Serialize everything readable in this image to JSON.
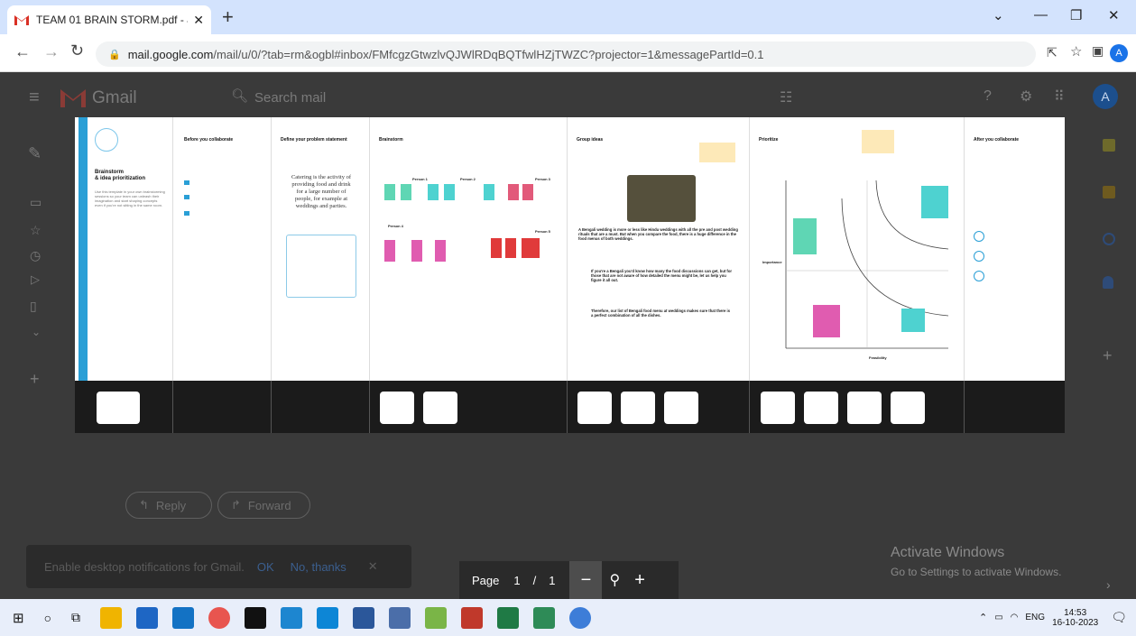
{
  "browser": {
    "tab_title": "TEAM 01 BRAIN STORM.pdf - as",
    "url_host": "mail.google.com",
    "url_rest": "/mail/u/0/?tab=rm&ogbl#inbox/FMfcgzGtwzlvQJWlRDqBQTfwlHZjTWZC?projector=1&messagePartId=0.1",
    "profile_initial": "A"
  },
  "gmail": {
    "product": "Gmail",
    "search_placeholder": "Search mail",
    "reply": "Reply",
    "forward": "Forward",
    "notif_text": "Enable desktop notifications for Gmail.",
    "notif_ok": "OK",
    "notif_no": "No, thanks"
  },
  "doc": {
    "col1": {
      "title": "Brainstorm",
      "title2": "& idea prioritization",
      "body": "Use this template in your own brainstorming sessions so your team can unleash their imagination and start shaping concepts even if you're not sitting in the same room."
    },
    "col2": {
      "title": "Before you collaborate"
    },
    "col3": {
      "title": "Define your problem statement",
      "statement": "Catering is the activity of providing food and drink for a large number of people, for example at weddings and parties."
    },
    "col4": {
      "title": "Brainstorm",
      "person1": "Person 1",
      "person2": "Person 2",
      "person3": "Person 3",
      "person4": "Person 4",
      "person5": "Person 5"
    },
    "col5": {
      "title": "Group ideas",
      "p1": "A Bengali wedding is more or less like Hindu weddings with all the pre and post wedding rituals that are a must. But when you compare the food, there is a huge difference in the food menus of both weddings.",
      "p2": "If you're a Bengali you'd know how many the food discussions can get, but for those that are not aware of how detailed the menu might be, let us help you figure it all out.",
      "p3": "Therefore, our list of Bengali food menu at weddings makes sure that there is a perfect combination of all the dishes."
    },
    "col6": {
      "title": "Prioritize",
      "ylabel": "Importance",
      "xlabel": "Feasibility"
    },
    "col7": {
      "title": "After you collaborate"
    }
  },
  "viewer": {
    "page_label": "Page",
    "page_current": "1",
    "page_sep": "/",
    "page_total": "1"
  },
  "windows": {
    "activate_title": "Activate Windows",
    "activate_sub": "Go to Settings to activate Windows.",
    "lang": "ENG",
    "time": "14:53",
    "date": "16-10-2023"
  }
}
